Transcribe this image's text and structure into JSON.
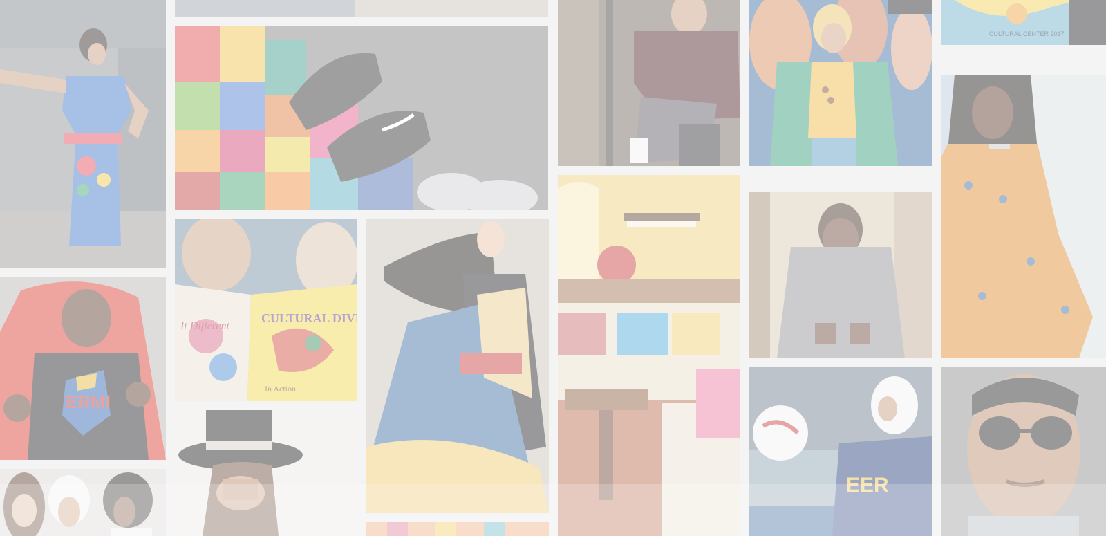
{
  "gallery": {
    "overlay_color": "#ffffff",
    "book_left_text": "It Different",
    "book_right_text": "CULTURAL DIVERSIT",
    "book_bottom_text": "In Action",
    "shirt_text": "ERMI",
    "sweatshirt_text": "EER",
    "poster_text": "CULTURAL CENTER 2017",
    "tiles": [
      {
        "name": "woman-blue-embroidered-dress-photo",
        "accent": "#4f7fc2"
      },
      {
        "name": "patterned-sneaker-ad-photo",
        "accent": "#d9a440"
      },
      {
        "name": "man-varsity-jacket-photo",
        "accent": "#6b2b2b"
      },
      {
        "name": "woman-mural-green-cardigan-photo",
        "accent": "#2f9a75"
      },
      {
        "name": "cultural-center-poster-photo",
        "accent": "#e6c84a"
      },
      {
        "name": "woman-orange-print-outfit-photo",
        "accent": "#e0872a"
      },
      {
        "name": "man-superman-shirt-hoodie-photo",
        "accent": "#c9362b"
      },
      {
        "name": "cultural-diversity-book-photo",
        "accent": "#e8c64a"
      },
      {
        "name": "woman-kimono-fashion-photo",
        "accent": "#3b6aa0"
      },
      {
        "name": "living-room-interior-photo",
        "accent": "#c9a86a"
      },
      {
        "name": "man-grey-hoodie-photo",
        "accent": "#9a9a9a"
      },
      {
        "name": "three-women-portrait-photo",
        "accent": "#444444"
      },
      {
        "name": "woman-black-hat-photo",
        "accent": "#222222"
      },
      {
        "name": "woman-hijab-soccer-photo",
        "accent": "#1f3a78"
      },
      {
        "name": "man-sunglasses-portrait-photo",
        "accent": "#3a3a3a"
      }
    ]
  }
}
